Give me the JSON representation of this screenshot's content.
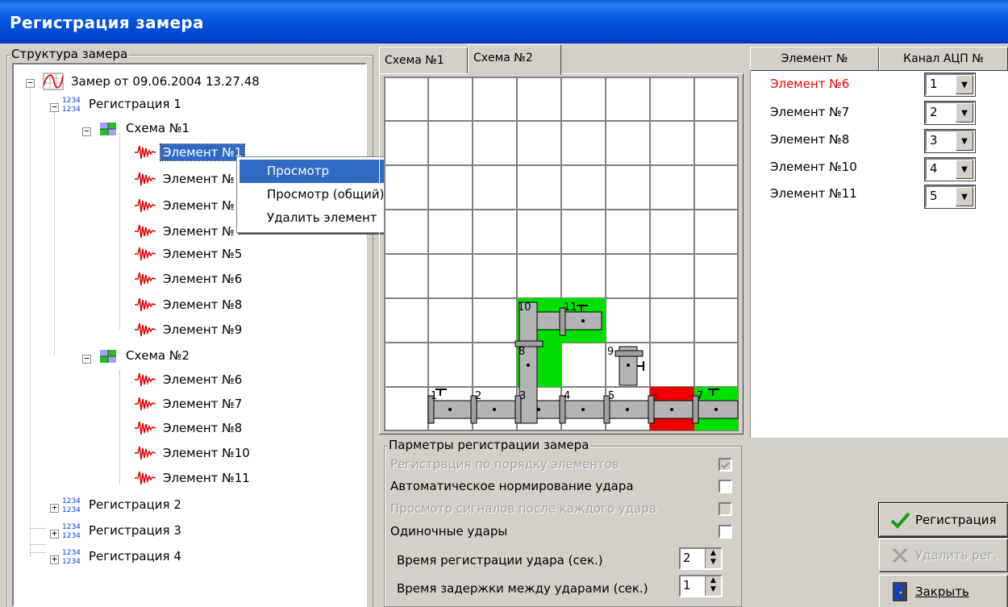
{
  "window": {
    "title": "Регистрация замера"
  },
  "structure": {
    "legend": "Структура замера",
    "root": "Замер от 09.06.2004 13.27.48",
    "registrations": [
      "Регистрация 1",
      "Регистрация 2",
      "Регистрация 3",
      "Регистрация 4"
    ],
    "schemes": [
      "Схема №1",
      "Схема №2"
    ],
    "scheme1_elements": [
      "Элемент №1",
      "Элемент №",
      "Элемент №",
      "Элемент №",
      "Элемент №5",
      "Элемент №6",
      "Элемент №8",
      "Элемент №9"
    ],
    "scheme2_elements": [
      "Элемент №6",
      "Элемент №7",
      "Элемент №8",
      "Элемент №10",
      "Элемент №11"
    ],
    "expander_minus": "−",
    "expander_plus": "+"
  },
  "context_menu": {
    "items": [
      "Просмотр",
      "Просмотр (общий)",
      "Удалить элемент"
    ]
  },
  "tabs": [
    "Схема №1",
    "Схема №2"
  ],
  "scheme": {
    "numbers": [
      "1",
      "2",
      "3",
      "4",
      "5",
      "6",
      "7",
      "8",
      "9",
      "10",
      "11"
    ],
    "colors": {
      "green": "#00e000",
      "red": "#ee0000",
      "pipe": "#b4b4b4",
      "grid": "#808080"
    }
  },
  "channels": {
    "headers": {
      "element": "Элемент №",
      "channel": "Канал АЦП №"
    },
    "rows": [
      {
        "element": "Элемент №6",
        "channel": "1",
        "color": "#ff0000"
      },
      {
        "element": "Элемент №7",
        "channel": "2",
        "color": "#000000"
      },
      {
        "element": "Элемент №8",
        "channel": "3",
        "color": "#000000"
      },
      {
        "element": "Элемент №10",
        "channel": "4",
        "color": "#000000"
      },
      {
        "element": "Элемент №11",
        "channel": "5",
        "color": "#000000"
      }
    ]
  },
  "params": {
    "legend": "Парметры регистрации замера",
    "by_order": "Регистрация по порядку элементов",
    "auto_norm": "Автоматическое нормирование удара",
    "view_signals": "Просмотр сигналов после каждого удара",
    "single": "Одиночные удары",
    "reg_time_label": "Время регистрации удара (сек.)",
    "reg_time": "2",
    "delay_label": "Время задержки между ударами (сек.)",
    "delay": "1",
    "spin_up": "▲",
    "spin_down": "▼"
  },
  "buttons": {
    "register": "Регистрация",
    "delete": "Удалить рег.",
    "close": "Закрыть"
  },
  "icons": {
    "dropdown": "▼"
  }
}
